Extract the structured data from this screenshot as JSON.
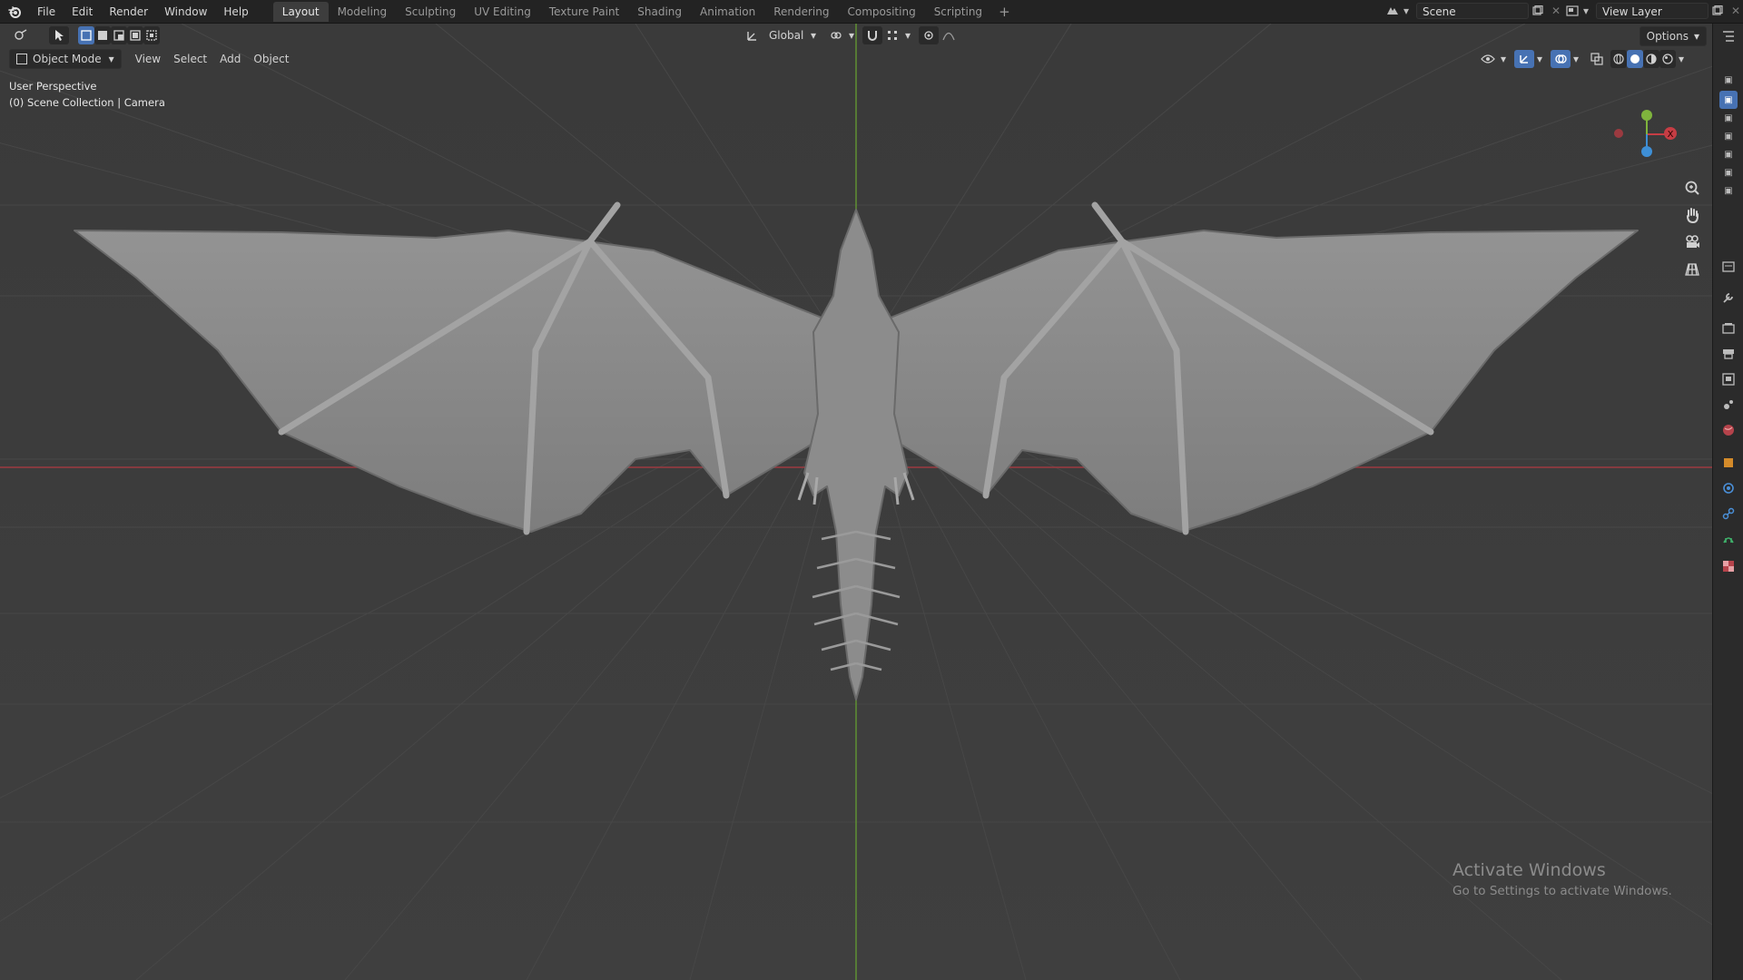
{
  "menu": {
    "items": [
      "File",
      "Edit",
      "Render",
      "Window",
      "Help"
    ]
  },
  "workspaces": {
    "tabs": [
      "Layout",
      "Modeling",
      "Sculpting",
      "UV Editing",
      "Texture Paint",
      "Shading",
      "Animation",
      "Rendering",
      "Compositing",
      "Scripting"
    ],
    "active": "Layout",
    "add_label": "+"
  },
  "scene": {
    "name": "Scene"
  },
  "view_layer": {
    "name": "View Layer"
  },
  "viewport_header": {
    "transform_orientation": "Global",
    "options_label": "Options"
  },
  "viewport_header2": {
    "mode": "Object Mode",
    "menus": [
      "View",
      "Select",
      "Add",
      "Object"
    ]
  },
  "overlay": {
    "perspective": "User Perspective",
    "collection": "(0) Scene Collection | Camera"
  },
  "gizmo": {
    "x_label": "X"
  },
  "watermark": {
    "title": "Activate Windows",
    "subtitle": "Go to Settings to activate Windows."
  },
  "colors": {
    "x_axis": "#c63d44",
    "y_axis": "#7fb43d",
    "z_axis": "#3e8fd6",
    "accent": "#4772b3",
    "grid": "#464646",
    "model": "#8a8a8a"
  }
}
